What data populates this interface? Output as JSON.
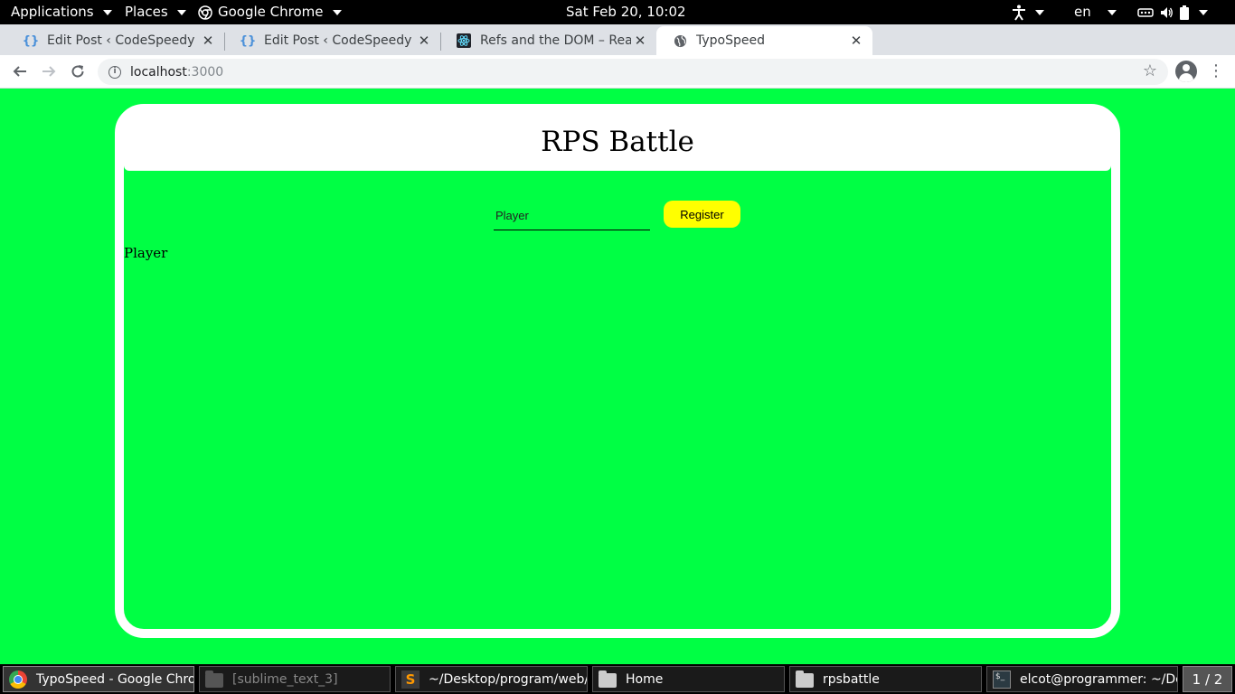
{
  "topbar": {
    "applications": "Applications",
    "places": "Places",
    "browser": "Google Chrome",
    "clock": "Sat Feb 20, 10:02",
    "language": "en",
    "icons": [
      "accessibility-icon",
      "network-icon",
      "volume-icon",
      "battery-icon"
    ]
  },
  "tabs": [
    {
      "title": "Edit Post ‹ CodeSpeedy —",
      "icon": "brace-icon",
      "active": false
    },
    {
      "title": "Edit Post ‹ CodeSpeedy —",
      "icon": "brace-icon",
      "active": false
    },
    {
      "title": "Refs and the DOM – React",
      "icon": "react-icon",
      "active": false
    },
    {
      "title": "TypoSpeed",
      "icon": "globe-icon",
      "active": true
    }
  ],
  "address": {
    "host": "localhost",
    "port": ":3000"
  },
  "page": {
    "title": "RPS Battle",
    "input_placeholder": "Player",
    "register_label": "Register",
    "player_label": "Player"
  },
  "taskbar": {
    "items": [
      {
        "label": "TypoSpeed - Google Chro...",
        "icon": "chrome-icon"
      },
      {
        "label": "[sublime_text_3]",
        "icon": "folder-icon"
      },
      {
        "label": "~/Desktop/program/web/r...",
        "icon": "sublime-icon"
      },
      {
        "label": "Home",
        "icon": "folder-icon"
      },
      {
        "label": "rpsbattle",
        "icon": "folder-icon"
      },
      {
        "label": "elcot@programmer: ~/Des...",
        "icon": "terminal-icon"
      }
    ],
    "workspace": "1 / 2"
  },
  "colors": {
    "page_background": "#00ff44",
    "register_button": "#ffff00",
    "frame": "#ffffff"
  }
}
